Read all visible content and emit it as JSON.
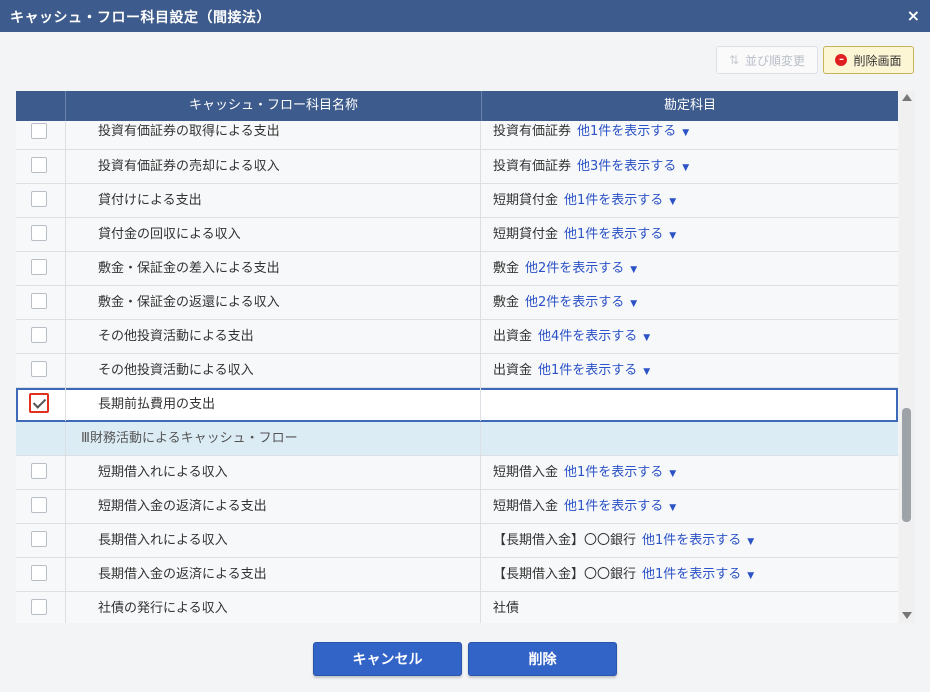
{
  "window": {
    "title": "キャッシュ・フロー科目設定（間接法）",
    "close_glyph": "×"
  },
  "toolbar": {
    "sort_label": "並び順変更",
    "sort_icon": "sort-arrows-icon",
    "delete_screen_label": "削除画面",
    "delete_screen_icon": "minus-circle-icon"
  },
  "table": {
    "headers": [
      "キャッシュ・フロー科目名称",
      "勘定科目"
    ],
    "rows": [
      {
        "name": "投資有価証券の取得による支出",
        "account": "投資有価証券",
        "more": "他1件を表示する",
        "checked": false,
        "type": "item"
      },
      {
        "name": "投資有価証券の売却による収入",
        "account": "投資有価証券",
        "more": "他3件を表示する",
        "checked": false,
        "type": "item"
      },
      {
        "name": "貸付けによる支出",
        "account": "短期貸付金",
        "more": "他1件を表示する",
        "checked": false,
        "type": "item"
      },
      {
        "name": "貸付金の回収による収入",
        "account": "短期貸付金",
        "more": "他1件を表示する",
        "checked": false,
        "type": "item"
      },
      {
        "name": "敷金・保証金の差入による支出",
        "account": "敷金",
        "more": "他2件を表示する",
        "checked": false,
        "type": "item"
      },
      {
        "name": "敷金・保証金の返還による収入",
        "account": "敷金",
        "more": "他2件を表示する",
        "checked": false,
        "type": "item"
      },
      {
        "name": "その他投資活動による支出",
        "account": "出資金",
        "more": "他4件を表示する",
        "checked": false,
        "type": "item"
      },
      {
        "name": "その他投資活動による収入",
        "account": "出資金",
        "more": "他1件を表示する",
        "checked": false,
        "type": "item"
      },
      {
        "name": "長期前払費用の支出",
        "account": "",
        "more": "",
        "checked": true,
        "type": "item"
      },
      {
        "name": "Ⅲ財務活動によるキャッシュ・フロー",
        "account": "",
        "more": "",
        "checked": false,
        "type": "section"
      },
      {
        "name": "短期借入れによる収入",
        "account": "短期借入金",
        "more": "他1件を表示する",
        "checked": false,
        "type": "item"
      },
      {
        "name": "短期借入金の返済による支出",
        "account": "短期借入金",
        "more": "他1件を表示する",
        "checked": false,
        "type": "item"
      },
      {
        "name": "長期借入れによる収入",
        "account": "【長期借入金】〇〇銀行",
        "more": "他1件を表示する",
        "checked": false,
        "type": "item"
      },
      {
        "name": "長期借入金の返済による支出",
        "account": "【長期借入金】〇〇銀行",
        "more": "他1件を表示する",
        "checked": false,
        "type": "item"
      },
      {
        "name": "社債の発行による収入",
        "account": "社債",
        "more": "",
        "checked": false,
        "type": "item"
      }
    ]
  },
  "footer": {
    "cancel_label": "キャンセル",
    "delete_label": "削除"
  },
  "colors": {
    "header_bg": "#3d5b8c",
    "link": "#2b52c6",
    "section_bg": "#dcecf5",
    "primary_button": "#3264c8",
    "highlight_border": "#e03020"
  }
}
